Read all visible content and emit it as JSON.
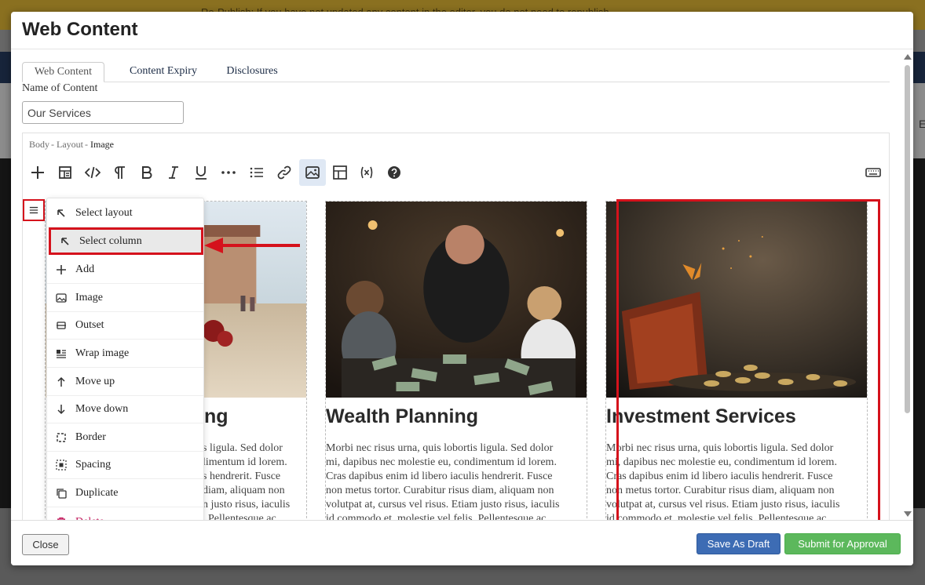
{
  "background": {
    "banner_text": "Re-Publish: If you have not updated any content in the editor, you do not need to republish.",
    "edge_letter": "E"
  },
  "modal": {
    "title": "Web Content",
    "tabs": [
      {
        "label": "Web Content",
        "active": true
      },
      {
        "label": "Content Expiry",
        "active": false
      },
      {
        "label": "Disclosures",
        "active": false
      }
    ],
    "name_label": "Name of Content",
    "name_value": "Our Services"
  },
  "editor": {
    "breadcrumb": [
      "Body",
      "Layout",
      "Image"
    ],
    "breadcrumb_sep": "-",
    "toolbar": [
      {
        "icon": "plus-icon",
        "active": false
      },
      {
        "icon": "layout-icon",
        "active": false
      },
      {
        "icon": "code-icon",
        "active": false
      },
      {
        "icon": "paragraph-icon",
        "active": false
      },
      {
        "icon": "bold-icon",
        "active": false
      },
      {
        "icon": "italic-icon",
        "active": false
      },
      {
        "icon": "underline-icon",
        "active": false
      },
      {
        "icon": "more-icon",
        "active": false
      },
      {
        "icon": "list-icon",
        "active": false
      },
      {
        "icon": "link-icon",
        "active": false
      },
      {
        "icon": "image-icon",
        "active": true
      },
      {
        "icon": "table-icon",
        "active": false
      },
      {
        "icon": "variable-icon",
        "active": false
      },
      {
        "icon": "help-icon",
        "active": false
      },
      {
        "icon": "keyboard-icon",
        "active": false
      }
    ],
    "columns": [
      {
        "title": "Financial Planning",
        "title_visible": "ng",
        "image": "beach-photo",
        "body": "Morbi nec risus urna, quis lobortis ligula. Sed dolor mi, dapibus nec molestie eu, condimentum id lorem. Cras dapibus enim id libero iaculis hendrerit. Fusce non metus tortor. Curabitur risus diam, aliquam non volutpat at, cursus vel risus. Etiam justo risus, iaculis id commodo et, molestie vel felis. Pellentesque ac",
        "body_visible_lines": [
          "s ligula. Sed dolor",
          "limentum id lorem.",
          "s hendrerit. Fusce",
          "diam, aliquam non",
          "n justo risus, iaculis",
          ". Pellentesque ac"
        ]
      },
      {
        "title": "Wealth Planning",
        "image": "family-money-photo",
        "body_lines": [
          "Morbi nec risus urna, quis lobortis ligula. Sed dolor",
          "mi, dapibus nec molestie eu, condimentum id lorem.",
          "Cras dapibus enim id libero iaculis hendrerit. Fusce",
          "non metus tortor. Curabitur risus diam, aliquam non",
          "volutpat at, cursus vel risus. Etiam justo risus, iaculis",
          "id commodo et, molestie vel felis. Pellentesque ac"
        ]
      },
      {
        "title": "Investment Services",
        "image": "wallet-butterfly-photo",
        "selected": true,
        "body_lines": [
          "Morbi nec risus urna, quis lobortis ligula. Sed dolor",
          "mi, dapibus nec molestie eu, condimentum id lorem.",
          "Cras dapibus enim id libero iaculis hendrerit. Fusce",
          "non metus tortor. Curabitur risus diam, aliquam non",
          "volutpat at, cursus vel risus. Etiam justo risus, iaculis",
          "id commodo et, molestie vel felis. Pellentesque ac"
        ]
      }
    ],
    "handle_icon": "hamburger-icon"
  },
  "context_menu": {
    "items": [
      {
        "label": "Select layout",
        "icon": "arrow-up-left-icon",
        "highlighted": false,
        "danger": false
      },
      {
        "label": "Select column",
        "icon": "arrow-up-left-icon",
        "highlighted": true,
        "danger": false
      },
      {
        "label": "Add",
        "icon": "plus-icon",
        "highlighted": false,
        "danger": false
      },
      {
        "label": "Image",
        "icon": "image-icon",
        "highlighted": false,
        "danger": false
      },
      {
        "label": "Outset",
        "icon": "outset-icon",
        "highlighted": false,
        "danger": false
      },
      {
        "label": "Wrap image",
        "icon": "wrap-image-icon",
        "highlighted": false,
        "danger": false
      },
      {
        "label": "Move up",
        "icon": "arrow-up-icon",
        "highlighted": false,
        "danger": false
      },
      {
        "label": "Move down",
        "icon": "arrow-down-icon",
        "highlighted": false,
        "danger": false
      },
      {
        "label": "Border",
        "icon": "border-icon",
        "highlighted": false,
        "danger": false
      },
      {
        "label": "Spacing",
        "icon": "spacing-icon",
        "highlighted": false,
        "danger": false
      },
      {
        "label": "Duplicate",
        "icon": "duplicate-icon",
        "highlighted": false,
        "danger": false
      },
      {
        "label": "Delete",
        "icon": "trash-icon",
        "highlighted": false,
        "danger": true
      }
    ]
  },
  "footer": {
    "close_label": "Close",
    "draft_label": "Save As Draft",
    "submit_label": "Submit for Approval"
  },
  "colors": {
    "annotation_red": "#d5121c",
    "draft_blue": "#3d6cb4",
    "submit_green": "#5cb85c",
    "delete_pink": "#c2185b",
    "tab_text": "#1a2a44"
  }
}
